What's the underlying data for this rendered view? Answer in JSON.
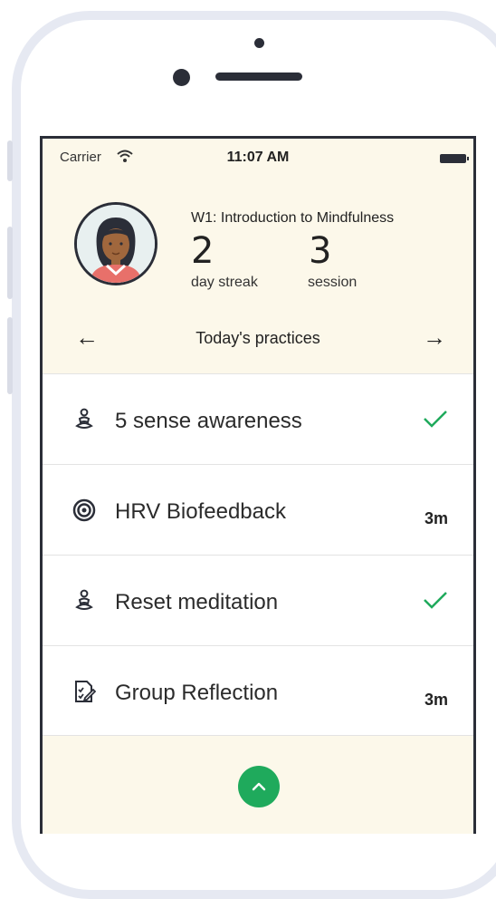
{
  "status_bar": {
    "carrier": "Carrier",
    "time": "11:07 AM"
  },
  "header": {
    "week_title": "W1: Introduction to Mindfulness",
    "streak_value": "2",
    "streak_label": "day streak",
    "session_value": "3",
    "session_label": "session"
  },
  "nav": {
    "prev_arrow": "←",
    "title": "Today's practices",
    "next_arrow": "→"
  },
  "practices": [
    {
      "label": "5 sense awareness",
      "icon": "meditation-icon",
      "status": "completed"
    },
    {
      "label": "HRV Biofeedback",
      "icon": "target-icon",
      "duration": "3m"
    },
    {
      "label": "Reset meditation",
      "icon": "meditation-icon",
      "status": "completed"
    },
    {
      "label": "Group Reflection",
      "icon": "reflection-icon",
      "duration": "3m"
    }
  ],
  "colors": {
    "header_bg": "#fcf8ea",
    "accent_green": "#1faa5c",
    "frame": "#e6e9f2",
    "dark": "#2b2e38"
  },
  "bottom_button_icon": "chevron-up-icon"
}
